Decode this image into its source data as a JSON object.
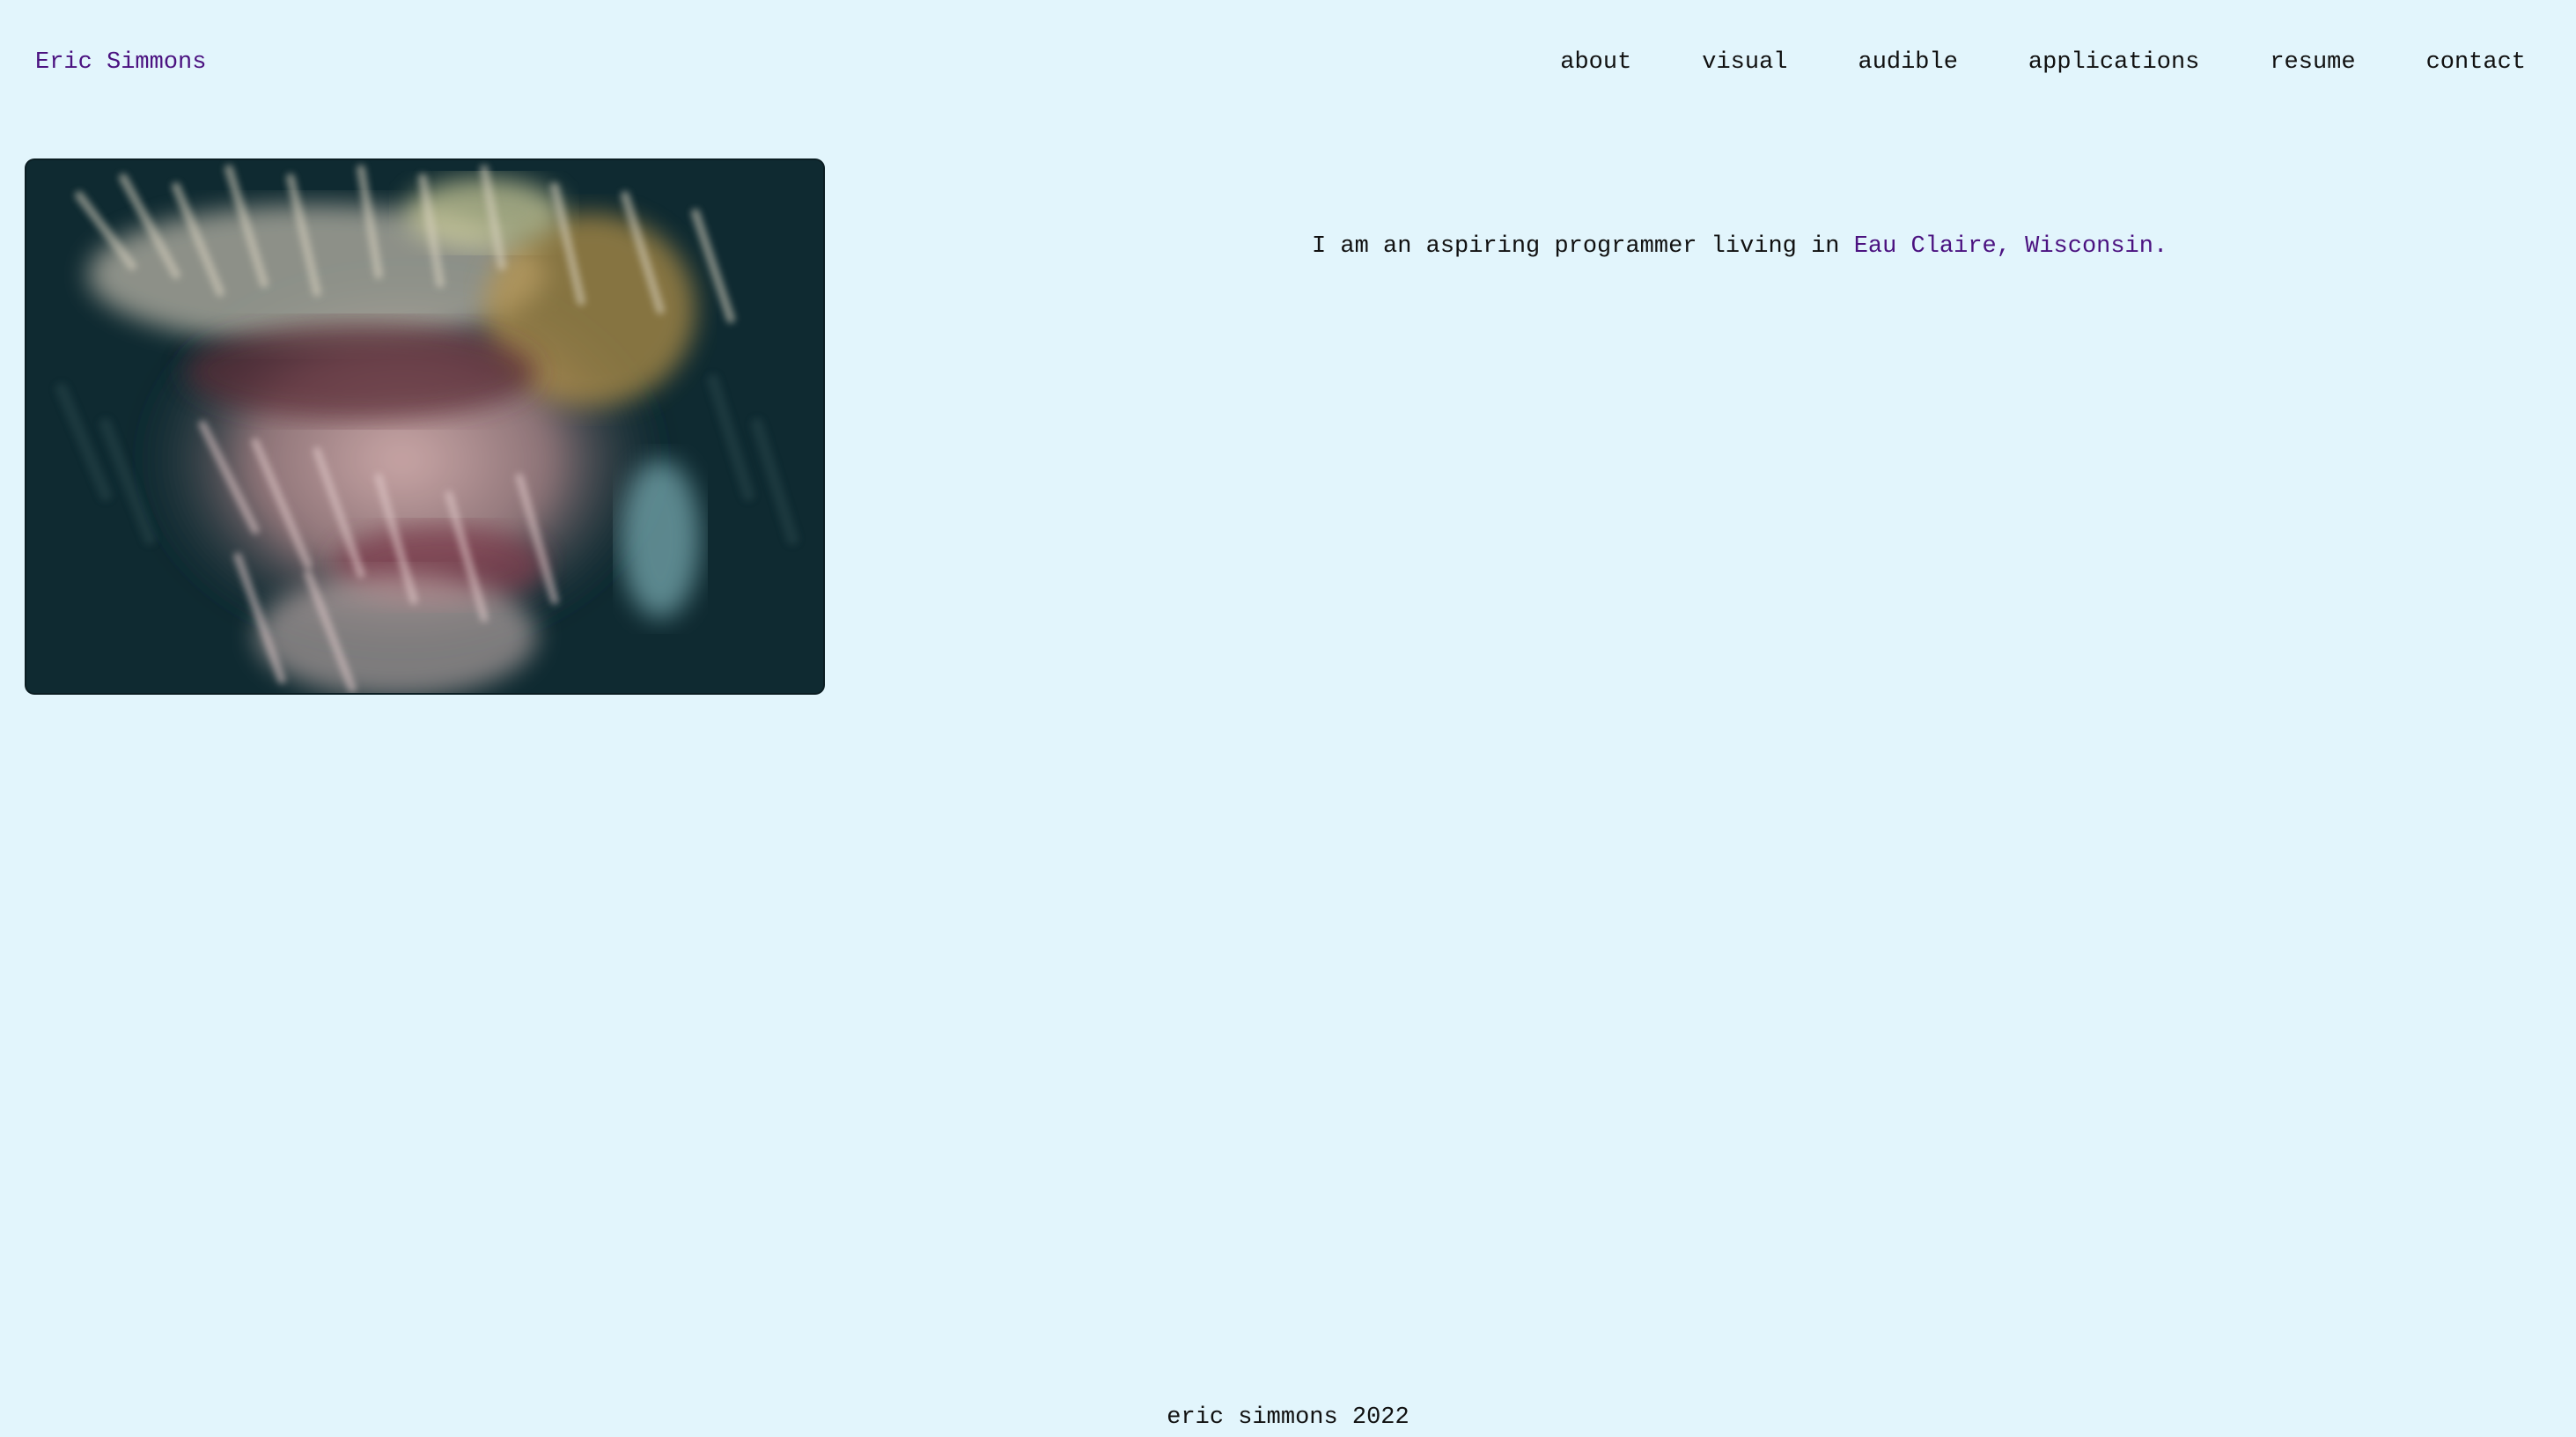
{
  "header": {
    "site_title": "Eric Simmons",
    "nav": [
      "about",
      "visual",
      "audible",
      "applications",
      "resume",
      "contact"
    ]
  },
  "main": {
    "intro_prefix": "I am an aspiring programmer living in",
    "intro_place": "Eau Claire, Wisconsin",
    "intro_suffix": "."
  },
  "footer": {
    "text": "eric simmons 2022"
  },
  "colors": {
    "background": "#e2f5fc",
    "accent": "#4b1280",
    "text": "#111111"
  }
}
